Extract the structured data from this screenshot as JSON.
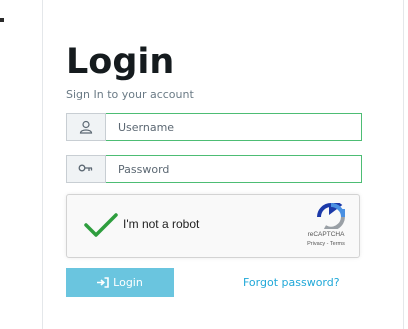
{
  "login": {
    "title": "Login",
    "subtitle": "Sign In to your account",
    "username_placeholder": "Username",
    "password_placeholder": "Password",
    "submit_label": "Login",
    "forgot_label": "Forgot password?"
  },
  "recaptcha": {
    "label": "I'm not a robot",
    "brand": "reCAPTCHA",
    "privacy": "Privacy",
    "separator": " - ",
    "terms": "Terms",
    "checked": true
  },
  "icons": {
    "username": "user-icon",
    "password": "key-icon",
    "submit": "sign-in-icon",
    "check": "checkmark-icon"
  },
  "colors": {
    "input_border": "#4dbd74",
    "button": "#63c2de",
    "link": "#20a8d8",
    "check": "#2e9e3e"
  }
}
